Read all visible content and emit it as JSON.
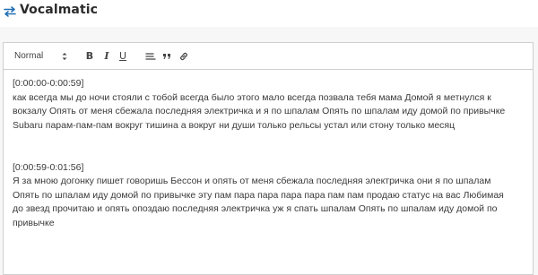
{
  "header": {
    "title": "Vocalmatic",
    "logo_icon": "swap-arrows-icon",
    "accent_color": "#1f6fb5"
  },
  "toolbar": {
    "format_value": "Normal",
    "bold_label": "B",
    "italic_label": "I",
    "underline_label": "U",
    "buttons": [
      "list-icon",
      "quote-icon",
      "link-icon"
    ]
  },
  "transcript": [
    {
      "timestamp": "[0:00:00-0:00:59]",
      "lines": [
        "как всегда мы до ночи стояли с тобой всегда было этого мало всегда позвала тебя мама Домой я метнулся к",
        "вокзалу Опять от меня сбежала последняя электричка и я по шпалам Опять по шпалам иду домой по привычке",
        "Subaru парам-пам-пам вокруг тишина а вокруг ни души только рельсы устал или стону только месяц"
      ]
    },
    {
      "timestamp": "[0:00:59-0:01:56]",
      "lines": [
        "Я за мною догонку пишет говоришь Бессон и опять от меня сбежала последняя электричка они я по шпалам",
        "Опять по шпалам иду домой по привычке эту пам пара пара пара пара пам пам продаю статус на вас Любимая",
        "до звезд прочитаю и опять опоздаю последняя электричка уж я спать шпалам Опять по шпалам иду домой по",
        "привычке"
      ]
    }
  ]
}
